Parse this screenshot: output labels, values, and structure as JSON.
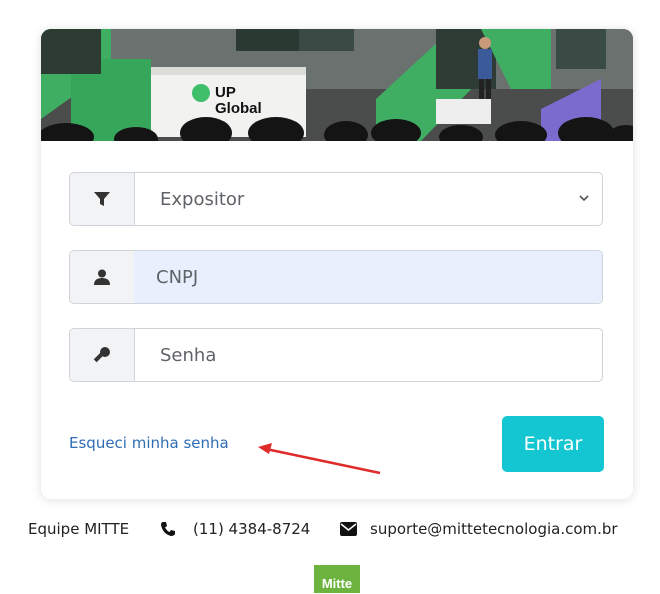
{
  "banner": {
    "logo_line1": "UP",
    "logo_line2": "Global"
  },
  "form": {
    "category_select": {
      "value": "Expositor",
      "icon": "filter-icon"
    },
    "cnpj_field": {
      "placeholder": "CNPJ",
      "icon": "user-icon"
    },
    "password_field": {
      "placeholder": "Senha",
      "icon": "key-icon"
    },
    "forgot_link": "Esqueci minha senha",
    "submit_label": "Entrar"
  },
  "footer": {
    "team": "Equipe MITTE",
    "phone": "(11) 4384-8724",
    "email": "suporte@mittetecnologia.com.br",
    "brand_logo_text": "Mitte"
  },
  "colors": {
    "accent": "#13c6d2",
    "link": "#2f6db5",
    "brand_green": "#6cb33f",
    "autofill_bg": "#e8f0fe"
  }
}
